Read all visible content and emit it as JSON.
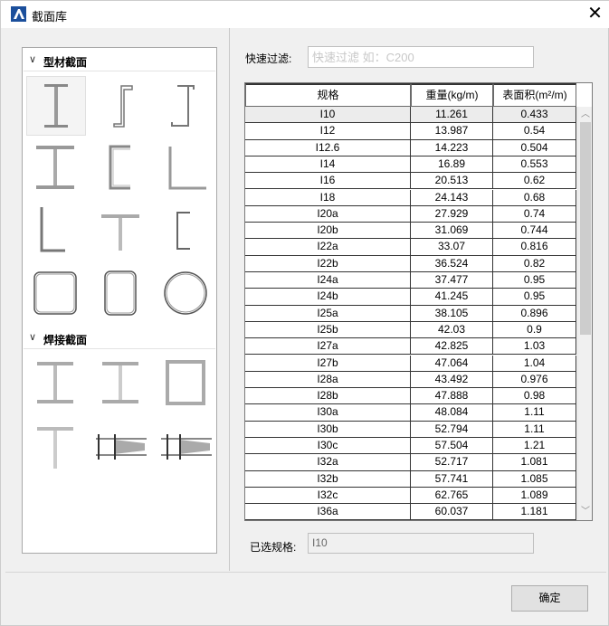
{
  "window": {
    "title": "截面库",
    "close_glyph": "✕"
  },
  "groups": [
    {
      "label": "型材截面",
      "chevron": "∨"
    },
    {
      "label": "焊接截面",
      "chevron": "∨"
    }
  ],
  "filter": {
    "label": "快速过滤:",
    "placeholder": "快速过滤 如：C200",
    "value": ""
  },
  "table": {
    "headers": [
      "规格",
      "重量(kg/m)",
      "表面积(m²/m)"
    ],
    "rows": [
      [
        "I10",
        "11.261",
        "0.433"
      ],
      [
        "I12",
        "13.987",
        "0.54"
      ],
      [
        "I12.6",
        "14.223",
        "0.504"
      ],
      [
        "I14",
        "16.89",
        "0.553"
      ],
      [
        "I16",
        "20.513",
        "0.62"
      ],
      [
        "I18",
        "24.143",
        "0.68"
      ],
      [
        "I20a",
        "27.929",
        "0.74"
      ],
      [
        "I20b",
        "31.069",
        "0.744"
      ],
      [
        "I22a",
        "33.07",
        "0.816"
      ],
      [
        "I22b",
        "36.524",
        "0.82"
      ],
      [
        "I24a",
        "37.477",
        "0.95"
      ],
      [
        "I24b",
        "41.245",
        "0.95"
      ],
      [
        "I25a",
        "38.105",
        "0.896"
      ],
      [
        "I25b",
        "42.03",
        "0.9"
      ],
      [
        "I27a",
        "42.825",
        "1.03"
      ],
      [
        "I27b",
        "47.064",
        "1.04"
      ],
      [
        "I28a",
        "43.492",
        "0.976"
      ],
      [
        "I28b",
        "47.888",
        "0.98"
      ],
      [
        "I30a",
        "48.084",
        "1.11"
      ],
      [
        "I30b",
        "52.794",
        "1.11"
      ],
      [
        "I30c",
        "57.504",
        "1.21"
      ],
      [
        "I32a",
        "52.717",
        "1.081"
      ],
      [
        "I32b",
        "57.741",
        "1.085"
      ],
      [
        "I32c",
        "62.765",
        "1.089"
      ],
      [
        "I36a",
        "60.037",
        "1.181"
      ]
    ],
    "selected_row": 0,
    "scroll_up_glyph": "︿",
    "scroll_down_glyph": "﹀"
  },
  "selected_spec": {
    "label": "已选规格:",
    "value": "I10"
  },
  "ok_button": {
    "label": "确定"
  }
}
